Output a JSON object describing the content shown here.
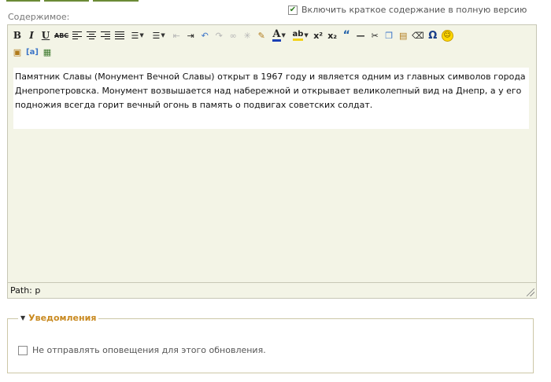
{
  "header": {
    "content_label": "Содержимое:",
    "summary_checkbox_label": "Включить краткое содержание в полную версию",
    "summary_checked": true
  },
  "toolbar": {
    "row1": [
      {
        "name": "bold-button",
        "glyph": "B"
      },
      {
        "name": "italic-button",
        "glyph": "I"
      },
      {
        "name": "underline-button",
        "glyph": "U"
      },
      {
        "name": "strikethrough-button",
        "glyph": "ABC"
      },
      {
        "name": "align-left-button",
        "glyph": ""
      },
      {
        "name": "align-center-button",
        "glyph": ""
      },
      {
        "name": "align-right-button",
        "glyph": ""
      },
      {
        "name": "align-justify-button",
        "glyph": ""
      },
      {
        "name": "bullet-list-button",
        "glyph": "☰"
      },
      {
        "name": "numbered-list-button",
        "glyph": "☰"
      },
      {
        "name": "outdent-button",
        "glyph": "⇤"
      },
      {
        "name": "indent-button",
        "glyph": "⇥"
      },
      {
        "name": "undo-button",
        "glyph": "↶"
      },
      {
        "name": "redo-button",
        "glyph": "↷"
      },
      {
        "name": "link-button",
        "glyph": "∞"
      },
      {
        "name": "unlink-button",
        "glyph": "✂"
      },
      {
        "name": "cleanup-button",
        "glyph": "✎"
      },
      {
        "name": "text-color-button",
        "glyph": "A"
      },
      {
        "name": "highlight-button",
        "glyph": "ab"
      },
      {
        "name": "superscript-button",
        "glyph": "x²"
      },
      {
        "name": "subscript-button",
        "glyph": "x₂"
      },
      {
        "name": "blockquote-button",
        "glyph": "“"
      },
      {
        "name": "horizontal-rule-button",
        "glyph": "—"
      },
      {
        "name": "cut-button",
        "glyph": "✂"
      },
      {
        "name": "copy-button",
        "glyph": "❐"
      },
      {
        "name": "paste-button",
        "glyph": "▤"
      },
      {
        "name": "remove-format-button",
        "glyph": "◇"
      },
      {
        "name": "special-char-button",
        "glyph": "Ω"
      },
      {
        "name": "emoticon-button",
        "glyph": "☺"
      }
    ],
    "row2": [
      {
        "name": "paste-text-button",
        "glyph": "T"
      },
      {
        "name": "paste-word-button",
        "glyph": "a"
      },
      {
        "name": "media-button",
        "glyph": "▦"
      }
    ]
  },
  "editor": {
    "content": "Памятник Славы (Монумент Вечной Славы) открыт в 1967 году и является одним из главных символов города Днепропетровска. Монумент возвышается над набережной и открывает великолепный вид на Днепр, а у его подножия всегда горит вечный огонь в память о подвигах советских солдат.",
    "path": "Path: p"
  },
  "notifications": {
    "legend": "Уведомления",
    "checkbox_label": "Не отправлять оповещения для этого обновления.",
    "checked": false
  }
}
